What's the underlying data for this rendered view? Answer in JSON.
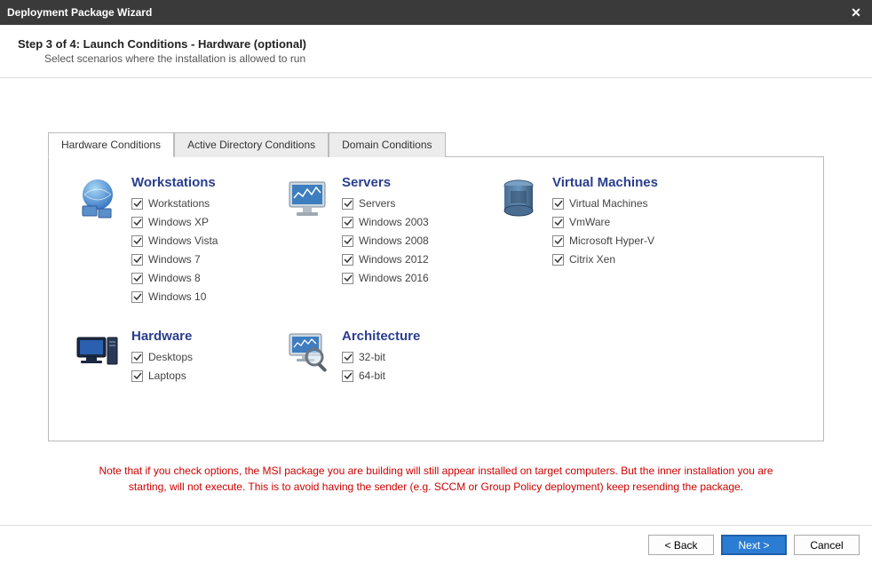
{
  "window": {
    "title": "Deployment Package Wizard"
  },
  "header": {
    "title": "Step 3 of 4: Launch Conditions - Hardware (optional)",
    "subtitle": "Select scenarios where the installation is allowed to run"
  },
  "tabs": [
    {
      "label": "Hardware Conditions"
    },
    {
      "label": "Active Directory Conditions"
    },
    {
      "label": "Domain Conditions"
    }
  ],
  "groups": {
    "workstations": {
      "title": "Workstations",
      "items": [
        {
          "label": "Workstations",
          "checked": true
        },
        {
          "label": "Windows XP",
          "checked": true
        },
        {
          "label": "Windows Vista",
          "checked": true
        },
        {
          "label": "Windows 7",
          "checked": true
        },
        {
          "label": "Windows 8",
          "checked": true
        },
        {
          "label": "Windows 10",
          "checked": true
        }
      ]
    },
    "servers": {
      "title": "Servers",
      "items": [
        {
          "label": "Servers",
          "checked": true
        },
        {
          "label": "Windows 2003",
          "checked": true
        },
        {
          "label": "Windows 2008",
          "checked": true
        },
        {
          "label": "Windows 2012",
          "checked": true
        },
        {
          "label": "Windows 2016",
          "checked": true
        }
      ]
    },
    "vms": {
      "title": "Virtual Machines",
      "items": [
        {
          "label": "Virtual Machines",
          "checked": true
        },
        {
          "label": "VmWare",
          "checked": true
        },
        {
          "label": "Microsoft Hyper-V",
          "checked": true
        },
        {
          "label": "Citrix Xen",
          "checked": true
        }
      ]
    },
    "hardware": {
      "title": "Hardware",
      "items": [
        {
          "label": "Desktops",
          "checked": true
        },
        {
          "label": "Laptops",
          "checked": true
        }
      ]
    },
    "architecture": {
      "title": "Architecture",
      "items": [
        {
          "label": "32-bit",
          "checked": true
        },
        {
          "label": "64-bit",
          "checked": true
        }
      ]
    }
  },
  "note": "Note that if you check options, the MSI package you are building will still appear installed on target computers. But the inner installation you are starting, will not execute. This is to avoid having the sender (e.g. SCCM or Group Policy deployment) keep resending the package.",
  "buttons": {
    "back": "< Back",
    "next": "Next >",
    "cancel": "Cancel"
  }
}
